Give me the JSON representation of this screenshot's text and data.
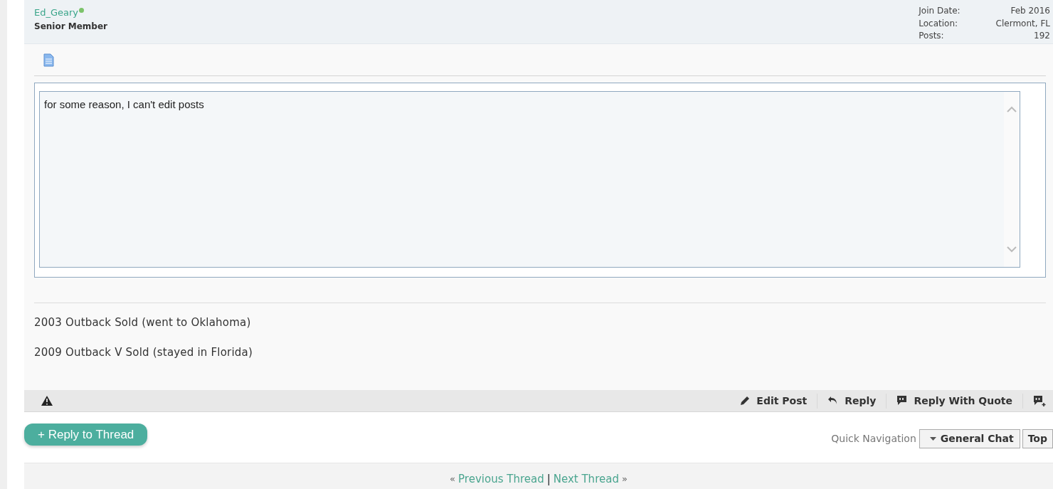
{
  "user": {
    "name": "Ed_Geary",
    "online": true,
    "rank": "Senior Member",
    "info": [
      {
        "label": "Join Date:",
        "value": "Feb 2016"
      },
      {
        "label": "Location:",
        "value": "Clermont, FL"
      },
      {
        "label": "Posts:",
        "value": "192"
      }
    ]
  },
  "post": {
    "message": "for some reason, I can't edit posts",
    "signature": [
      "2003 Outback Sold (went to Oklahoma)",
      "2009 Outback V Sold (stayed in Florida)"
    ]
  },
  "actions": [
    {
      "kind": "edit",
      "label": "Edit Post"
    },
    {
      "kind": "reply",
      "label": "Reply"
    },
    {
      "kind": "quote",
      "label": "Reply With Quote"
    },
    {
      "kind": "multiquote"
    }
  ],
  "reply_button": "+ Reply to Thread",
  "quick_navigation": {
    "label": "Quick Navigation",
    "forum": "General Chat",
    "top": "Top"
  },
  "thread_nav": {
    "prev_mark": "«",
    "prev": "Previous Thread",
    "separator": "|",
    "next": "Next Thread",
    "next_mark": "»"
  }
}
